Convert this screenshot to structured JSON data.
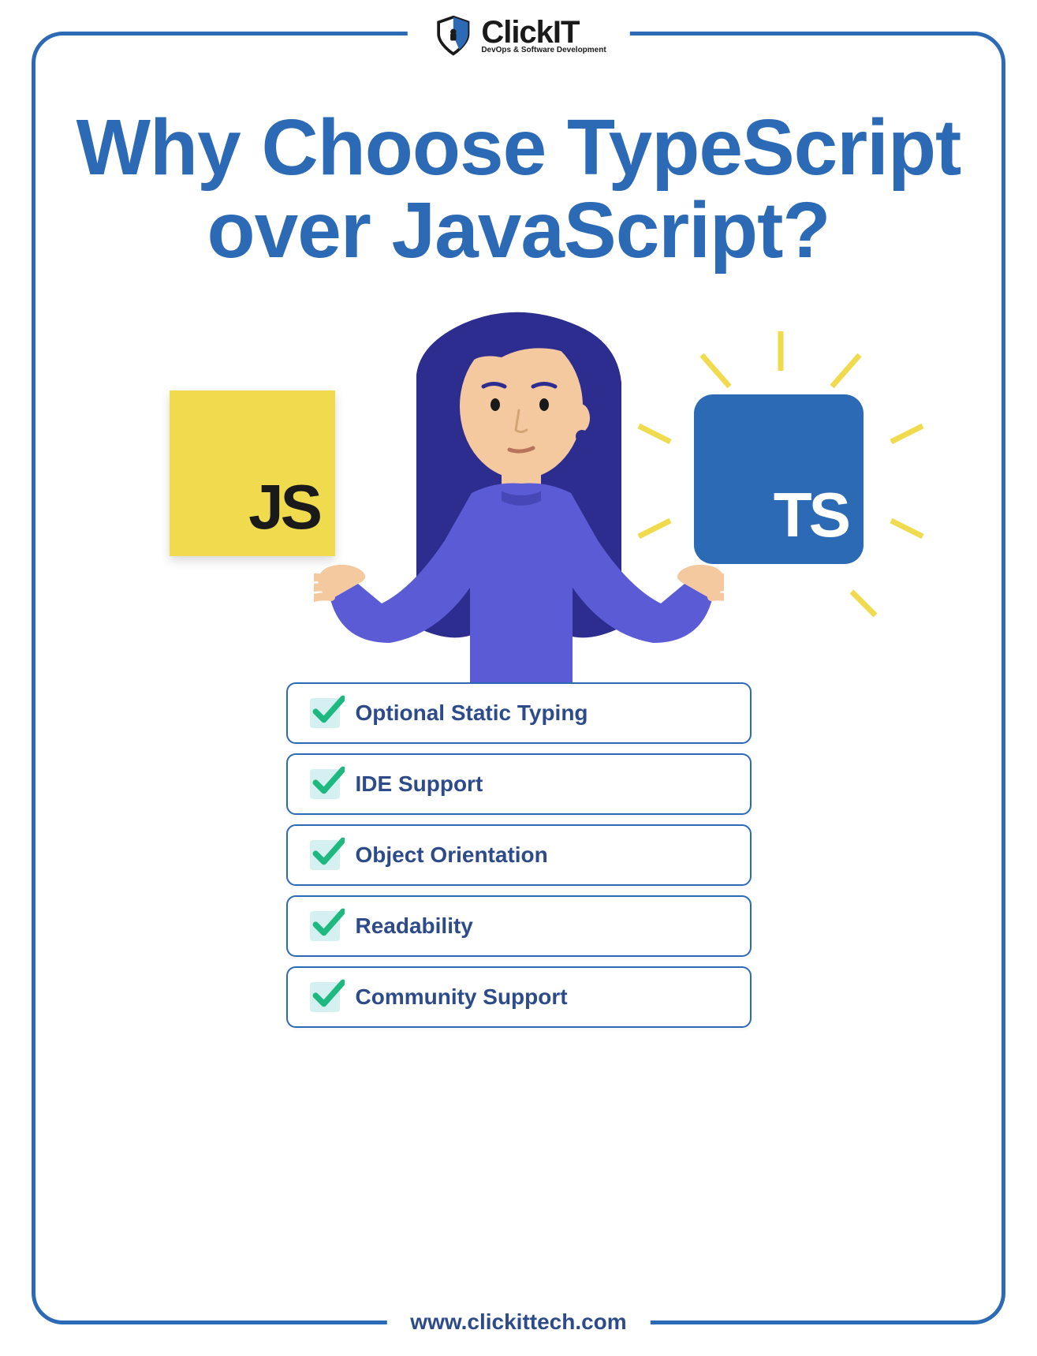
{
  "logo": {
    "main": "ClickIT",
    "tagline": "DevOps & Software Development"
  },
  "title": "Why Choose TypeScript over JavaScript?",
  "js_label": "JS",
  "ts_label": "TS",
  "features": [
    "Optional Static Typing",
    "IDE Support",
    "Object Orientation",
    "Readability",
    "Community Support"
  ],
  "footer_url": "www.clickittech.com"
}
